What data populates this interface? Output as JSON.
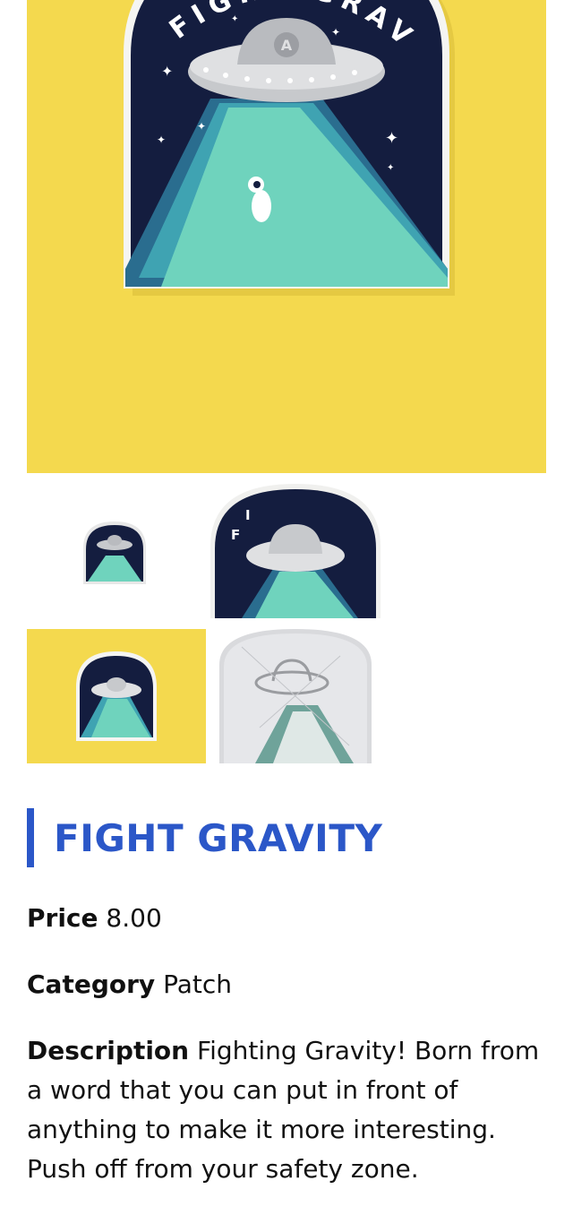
{
  "product": {
    "title": "FIGHT GRAVITY",
    "price_label": "Price",
    "price_value": "8.00",
    "category_label": "Category",
    "category_value": "Patch",
    "description_label": "Description",
    "description_value": "Fighting Gravity! Born from a word that you can put in front of anything to make it more interesting. Push off from your safety zone."
  },
  "patch": {
    "arc_text": "FIGHT GRAVITY",
    "badge_letter": "A"
  },
  "gallery": {
    "main_image": "patch-on-yellow",
    "thumbnails": [
      "patch-on-white",
      "patch-closeup",
      "patch-on-yellow",
      "patch-back"
    ]
  },
  "colors": {
    "accent": "#2b57c8",
    "yellow_bg": "#f4d94e",
    "navy": "#141d3f",
    "mint": "#6fd3bd",
    "teal": "#2a6d8f"
  }
}
